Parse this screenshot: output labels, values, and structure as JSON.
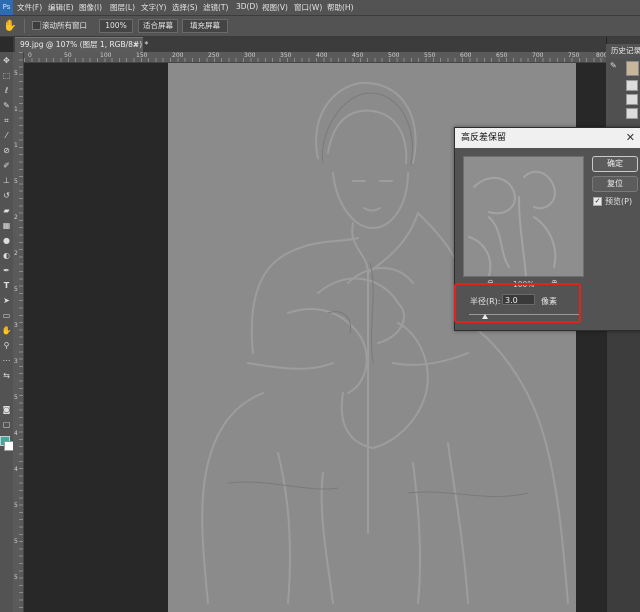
{
  "menubar": {
    "logo": "Ps",
    "items": [
      "文件(F)",
      "编辑(E)",
      "图像(I)",
      "图层(L)",
      "文字(Y)",
      "选择(S)",
      "滤镜(T)",
      "3D(D)",
      "视图(V)",
      "窗口(W)",
      "帮助(H)"
    ]
  },
  "optionsbar": {
    "hand_icon": "hand-icon",
    "scroll_all_windows": "滚动所有窗口",
    "zoom_100": "100%",
    "fit_screen": "适合屏幕",
    "fill_screen": "填充屏幕"
  },
  "document": {
    "tab_title": "99.jpg @ 107% (图层 1, RGB/8#) *",
    "tab_close": "×"
  },
  "rulers": {
    "top": [
      "0",
      "50",
      "100",
      "150",
      "200",
      "250",
      "300",
      "350",
      "400",
      "450",
      "500",
      "550",
      "600",
      "650",
      "700",
      "750",
      "800"
    ],
    "left": [
      "5",
      "1",
      "1",
      "5",
      "2",
      "2",
      "5",
      "3",
      "3",
      "5",
      "4",
      "4",
      "5",
      "5",
      "5"
    ]
  },
  "history_panel": {
    "title": "历史记录"
  },
  "dialog": {
    "title": "高反差保留",
    "close": "✕",
    "ok": "确定",
    "reset": "复位",
    "preview_label": "预览(P)",
    "preview_checked": "✓",
    "zoom_out": "⊖",
    "zoom_percent": "100%",
    "zoom_in": "⊕",
    "radius_label": "半径(R):",
    "radius_value": "3.0",
    "radius_unit": "像素"
  },
  "colors": {
    "foreground": "#3fa9a0",
    "background": "#ffffff",
    "highlight": "#e2231a"
  }
}
